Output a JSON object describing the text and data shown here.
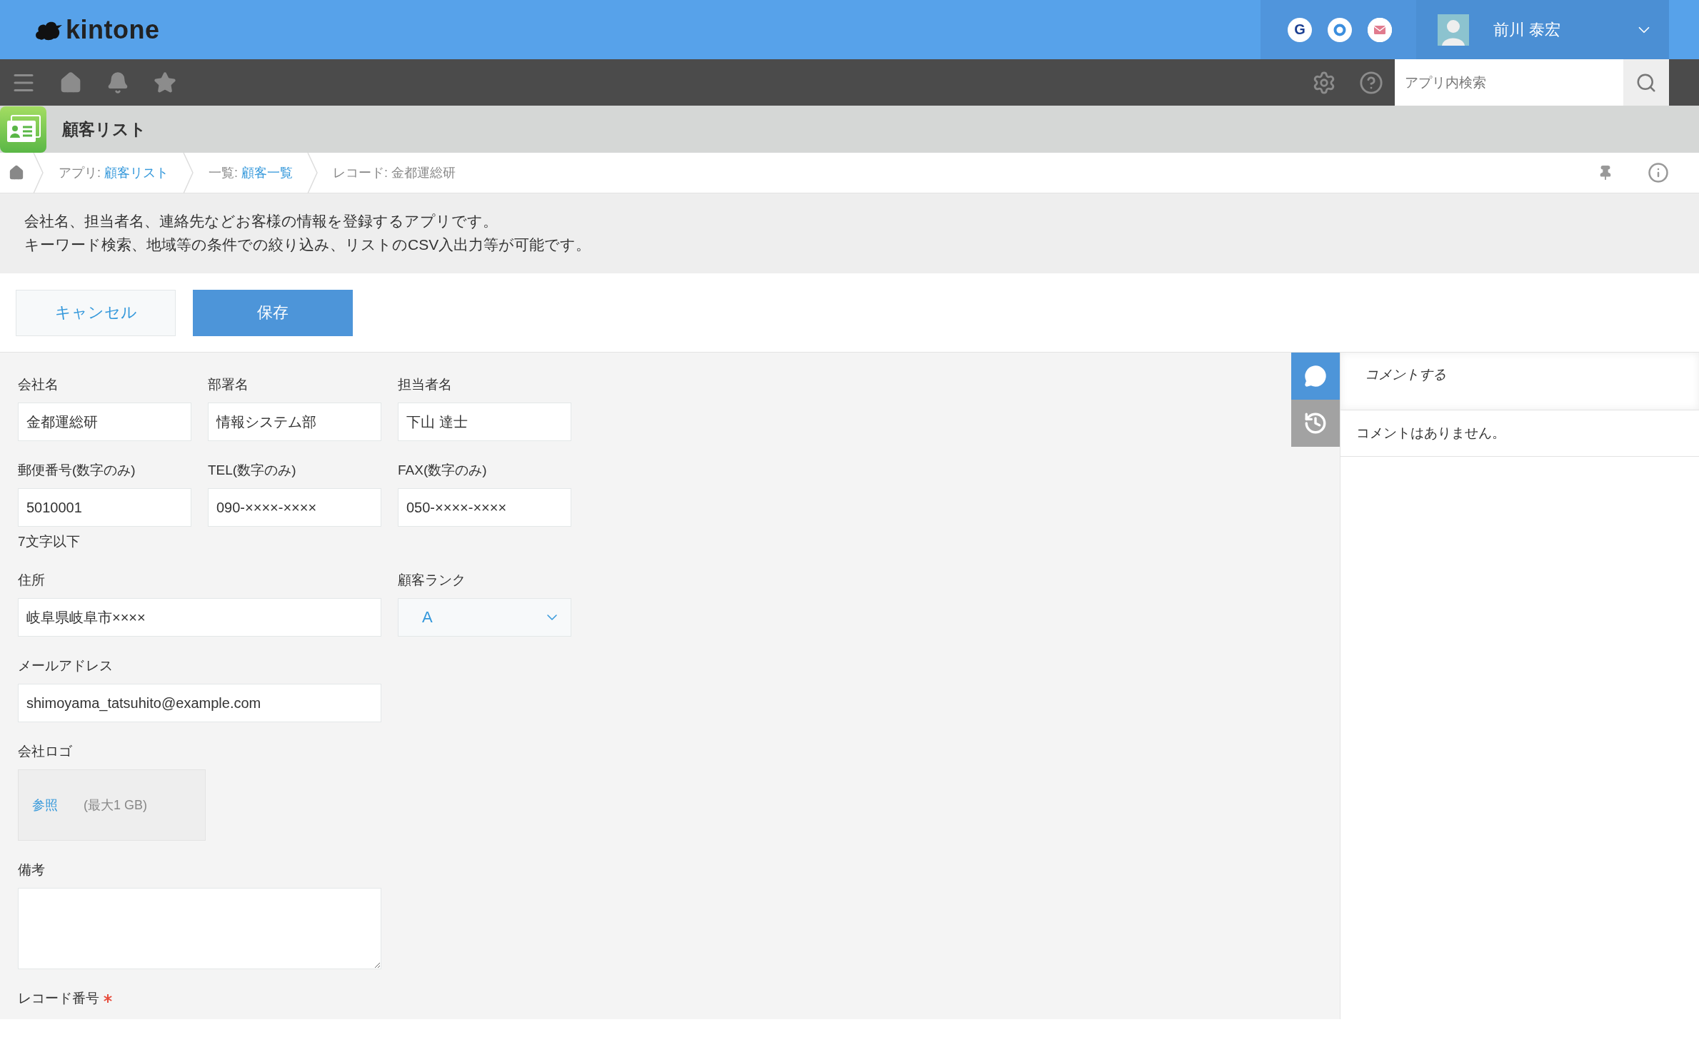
{
  "header": {
    "logo": "kintone",
    "service_icons": [
      {
        "kind": "letter",
        "text": "G"
      },
      {
        "kind": "ring"
      },
      {
        "kind": "mail"
      }
    ],
    "user_name": "前川 泰宏"
  },
  "search": {
    "placeholder": "アプリ内検索"
  },
  "app": {
    "title": "顧客リスト"
  },
  "breadcrumb": [
    {
      "label": "アプリ: ",
      "link": "顧客リスト"
    },
    {
      "label": "一覧: ",
      "link": "顧客一覧"
    },
    {
      "label": "レコード: 金都運総研"
    }
  ],
  "description": [
    "会社名、担当者名、連絡先などお客様の情報を登録するアプリです。",
    "キーワード検索、地域等の条件での絞り込み、リストのCSV入出力等が可能です。"
  ],
  "buttons": [
    {
      "label": "キャンセル",
      "kind": "secondary"
    },
    {
      "label": "保存",
      "kind": "primary"
    }
  ],
  "form": {
    "rows": [
      [
        {
          "kind": "short",
          "label": "会社名",
          "value": "金都運総研"
        },
        {
          "kind": "short",
          "label": "部署名",
          "value": "情報システム部"
        },
        {
          "kind": "short",
          "label": "担当者名",
          "value": "下山 達士"
        }
      ],
      [
        {
          "kind": "short",
          "label": "郵便番号(数字のみ)",
          "value": "5010001",
          "hint": "7文字以下"
        },
        {
          "kind": "short",
          "label": "TEL(数字のみ)",
          "value": "090-××××-××××"
        },
        {
          "kind": "short",
          "label": "FAX(数字のみ)",
          "value": "050-××××-××××"
        }
      ],
      [
        {
          "kind": "wide",
          "label": "住所",
          "value": "岐阜県岐阜市××××"
        },
        "",
        {
          "kind": "select",
          "label": "顧客ランク",
          "value": "A"
        }
      ],
      [
        {
          "kind": "wide",
          "label": "メールアドレス",
          "value": "shimoyama_tatsuhito@example.com"
        }
      ],
      [
        {
          "kind": "file",
          "label": "会社ロゴ",
          "link": "参照",
          "note": "(最大1 GB)"
        }
      ],
      [
        {
          "kind": "textarea",
          "label": "備考"
        }
      ],
      [
        {
          "kind": "heading",
          "label": "レコード番号",
          "required": true
        }
      ]
    ]
  },
  "sidebar": {
    "tabs": [
      {
        "kind": "comment",
        "selected": true
      },
      {
        "kind": "history",
        "selected": false
      }
    ],
    "comment_placeholder": "コメントする",
    "empty_message": "コメントはありません。"
  }
}
